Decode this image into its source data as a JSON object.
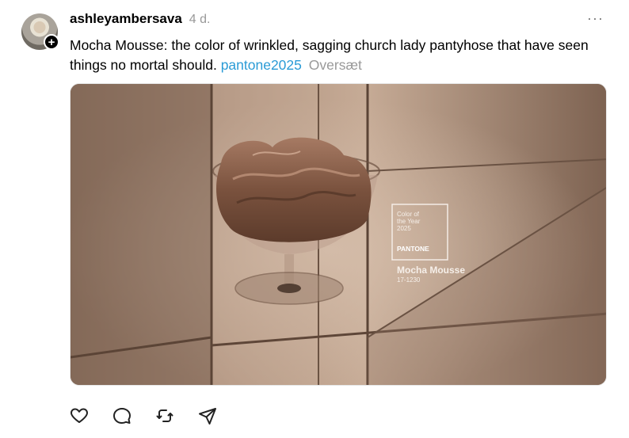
{
  "post": {
    "username": "ashleyambersava",
    "timestamp": "4 d.",
    "more_icon": "ellipsis-icon",
    "text": "Mocha Mousse: the color of wrinkled, sagging church lady pantyhose that have seen things no mortal should.",
    "hashtag": "pantone2025",
    "translate_label": "Oversæt"
  },
  "media": {
    "card_line1": "Color of",
    "card_line2": "the Year",
    "card_year": "2025",
    "card_brand": "PANTONE",
    "color_name": "Mocha Mousse",
    "color_code": "17-1230"
  },
  "actions": [
    {
      "name": "like",
      "icon": "heart-icon"
    },
    {
      "name": "reply",
      "icon": "comment-icon"
    },
    {
      "name": "repost",
      "icon": "repost-icon"
    },
    {
      "name": "share",
      "icon": "send-icon"
    }
  ]
}
